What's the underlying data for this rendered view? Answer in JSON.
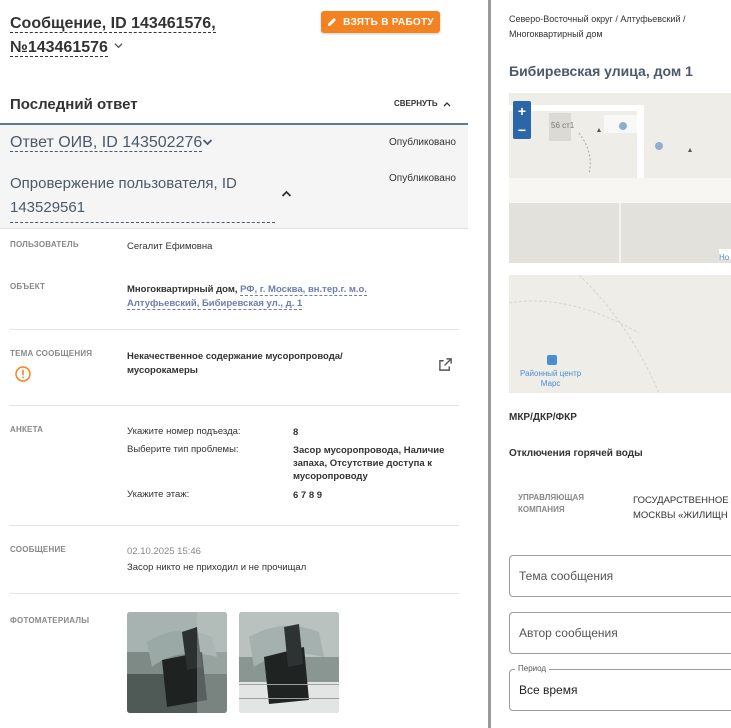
{
  "header": {
    "title_line1": "Сообщение, ID 143461576,",
    "title_line2": "№143461576",
    "take_button": "ВЗЯТЬ В РАБОТУ"
  },
  "last_answer": {
    "title": "Последний ответ",
    "collapse_label": "СВЕРНУТЬ"
  },
  "answers": [
    {
      "title": "Ответ ОИВ, ID 143502276",
      "status": "Опубликовано"
    },
    {
      "title": "Опровержение пользователя, ID 143529561",
      "status": "Опубликовано"
    }
  ],
  "details": {
    "user_label": "ПОЛЬЗОВАТЕЛЬ",
    "user_value": "Сегалит Ефимовна",
    "object_label": "ОБЪЕКТ",
    "object_type": "Многоквартирный дом,",
    "object_link_1": "РФ, г. Москва, вн.тер.г. м.о.",
    "object_link_2": "Алтуфьевский, Бибиревская ул., д. 1",
    "topic_label": "ТЕМА СООБЩЕНИЯ",
    "topic_line1": "Некачественное содержание мусоропровода/",
    "topic_line2": "мусорокамеры",
    "survey_label": "АНКЕТА",
    "survey": [
      {
        "q": "Укажите номер подъезда:",
        "a": "8"
      },
      {
        "q": "Выберите тип проблемы:",
        "a": "Засор мусоропровода, Наличие запаха, Отсутствие доступа к мусоропроводу"
      },
      {
        "q": "Укажите этаж:",
        "a": "6 7 8 9"
      }
    ],
    "message_label": "СООБЩЕНИЕ",
    "message_date": "02.10.2025 15:46",
    "message_text": "Засор никто не приходил и не прочищал",
    "photos_label": "ФОТОМАТЕРИАЛЫ"
  },
  "right": {
    "breadcrumb_line1": "Северо-Восточный округ / Алтуфьевский /",
    "breadcrumb_line2": "Многоквартирный дом",
    "address": "Бибиревская улица, дом 1",
    "map": {
      "zoom_in": "+",
      "zoom_out": "−",
      "label_house": "56 ст1",
      "label_center_line1": "Районный центр",
      "label_center_line2": "Марс",
      "label_edge": "Но"
    },
    "mkd_label": "МКР/ДКР/ФКР",
    "hot_water": "Отключения горячей воды",
    "uk_label": "УПРАВЛЯЮЩАЯ КОМПАНИЯ",
    "uk_value_line1": "ГОСУДАРСТВЕННОЕ",
    "uk_value_line2": "МОСКВЫ «ЖИЛИЩН",
    "topic_placeholder": "Тема сообщения",
    "author_placeholder": "Автор сообщения",
    "period_label": "Период",
    "period_value": "Все время"
  },
  "colors": {
    "accent_orange": "#f58220",
    "divider_blue": "#5e7896",
    "link": "#6a7fb0",
    "map_zoom": "#2a66a8"
  }
}
